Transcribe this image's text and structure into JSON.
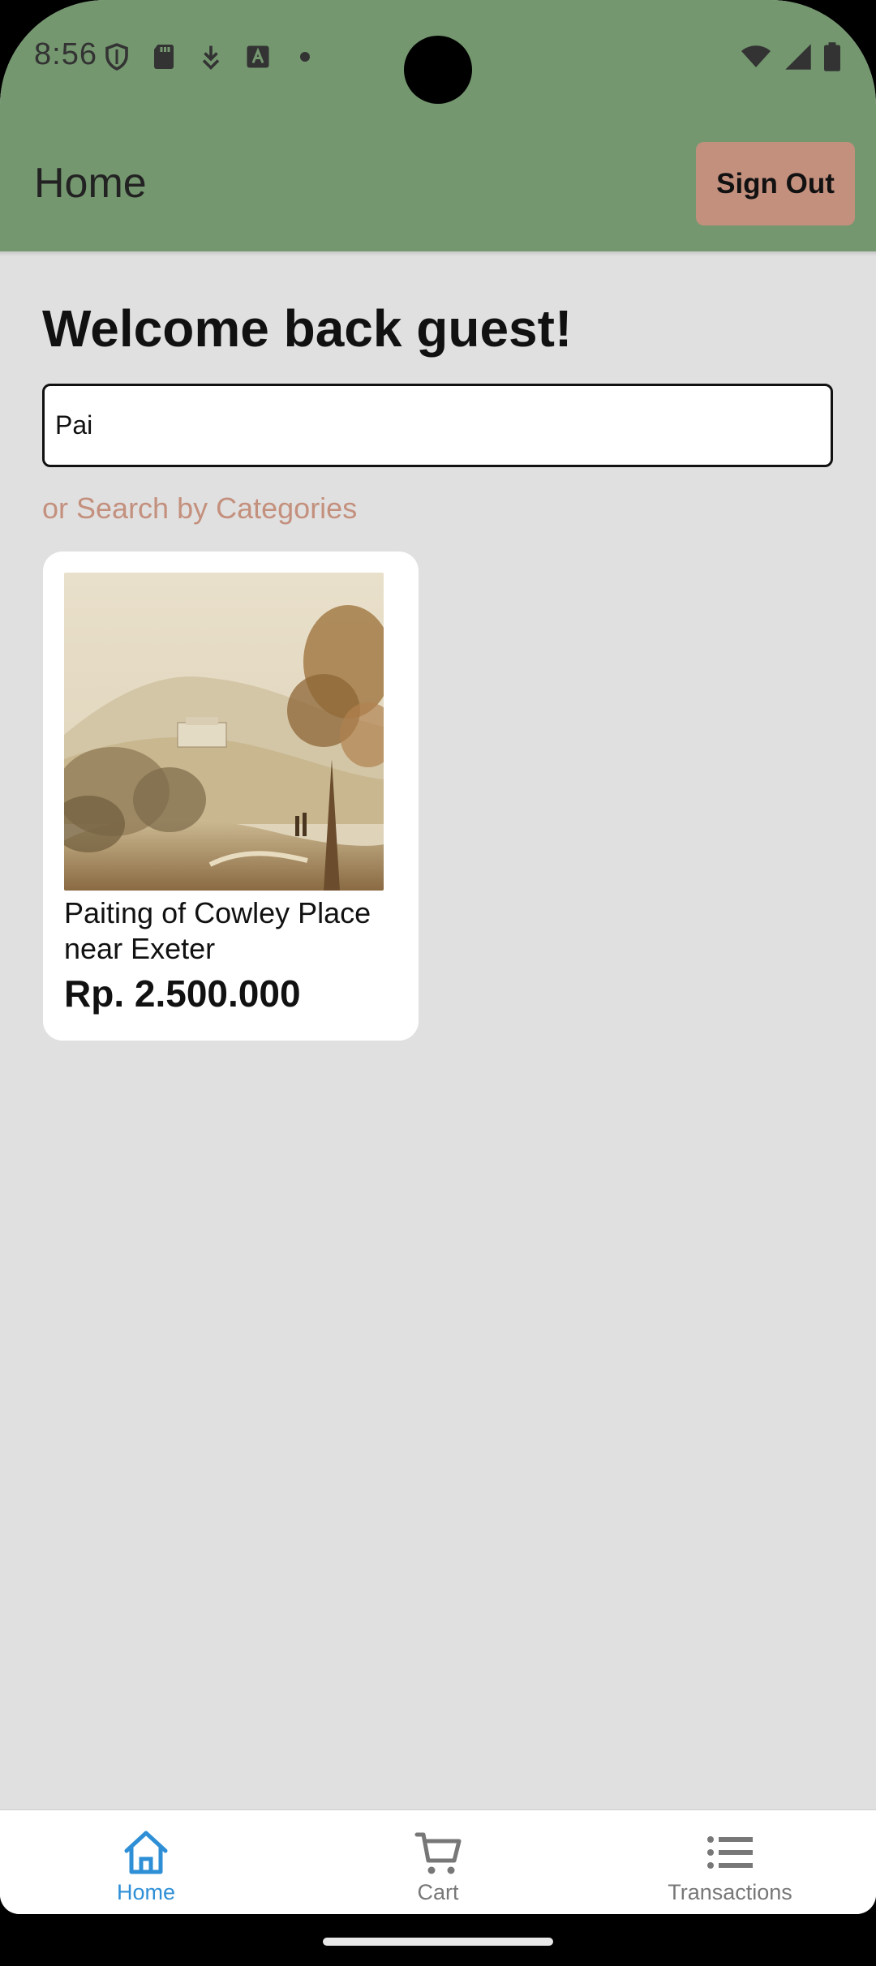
{
  "status_bar": {
    "time": "8:56"
  },
  "header": {
    "title": "Home",
    "sign_out_label": "Sign Out"
  },
  "main": {
    "welcome_text": "Welcome back guest!",
    "search": {
      "value": "Pai",
      "placeholder": ""
    },
    "category_link": "or Search by Categories",
    "products": [
      {
        "name": "Paiting of Cowley Place near Exeter",
        "price": "Rp. 2.500.000"
      }
    ]
  },
  "bottom_nav": {
    "items": [
      {
        "label": "Home",
        "icon": "home-icon",
        "active": true
      },
      {
        "label": "Cart",
        "icon": "cart-icon",
        "active": false
      },
      {
        "label": "Transactions",
        "icon": "list-icon",
        "active": false
      }
    ]
  },
  "colors": {
    "header_bg": "#74976f",
    "accent": "#c4907e",
    "active_nav": "#2e8fd6",
    "page_bg": "#e0e0e0"
  }
}
